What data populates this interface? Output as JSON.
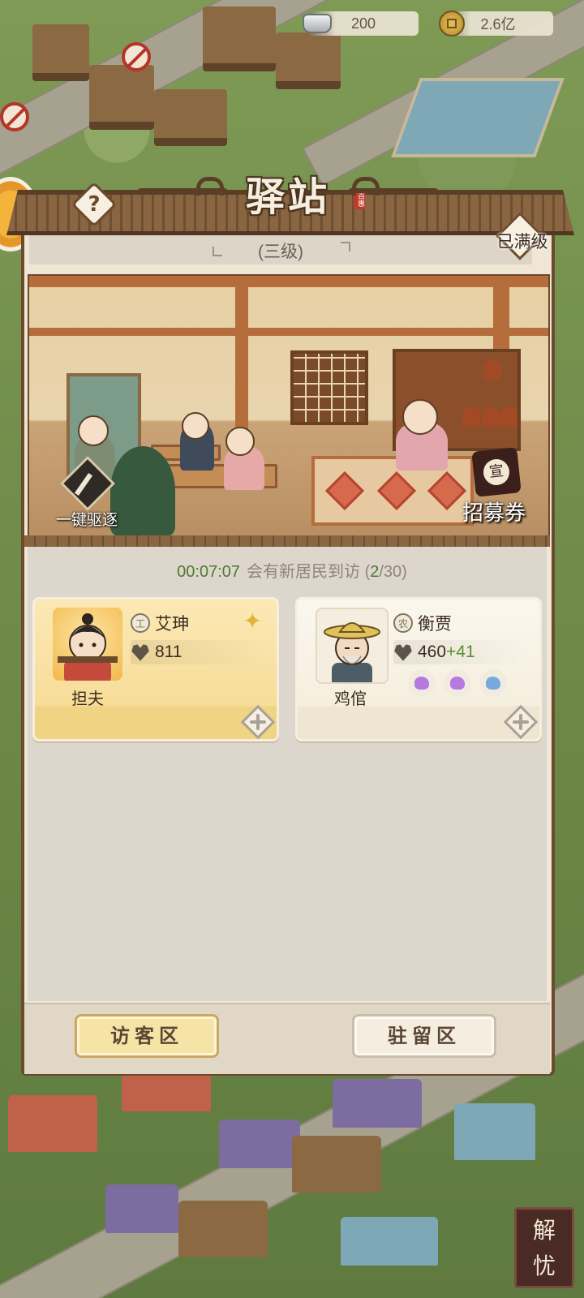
{
  "currency": {
    "silver": {
      "icon": "silver-ingot-icon",
      "value": "200"
    },
    "copper": {
      "icon": "copper-coin-icon",
      "value": "2.6亿"
    }
  },
  "panel": {
    "title": "驿站",
    "seal": "百惠",
    "level": "(三级)",
    "max_level_label": "已满级",
    "expel_label": "一键驱逐",
    "recruit_ticket": {
      "seal_char": "宣",
      "label": "招募券"
    }
  },
  "visitors": {
    "timer": "00:07:07",
    "message_prefix": "会有新居民到访 (",
    "count_current": "2",
    "count_total": "/30)",
    "cards": [
      {
        "job": "担夫",
        "tag_char": "工",
        "name": "艾珅",
        "value": "811",
        "bonus": "",
        "rarity": "gold"
      },
      {
        "job": "鸡倌",
        "tag_char": "农",
        "name": "衡贾",
        "value": "460",
        "bonus": "+41",
        "rarity": "plain",
        "chickens": [
          "#b679dd",
          "#b679dd",
          "#77a9e0"
        ]
      }
    ]
  },
  "tabs": {
    "visitor_area": "访客区",
    "stay_area": "驻留区"
  },
  "corner_button": "解忧",
  "colors": {
    "frame_wood": "#6b4b2c",
    "timer_green": "#4d7a2f",
    "bonus_green": "#5a8d2e",
    "gold_card": "#f7dd98"
  }
}
